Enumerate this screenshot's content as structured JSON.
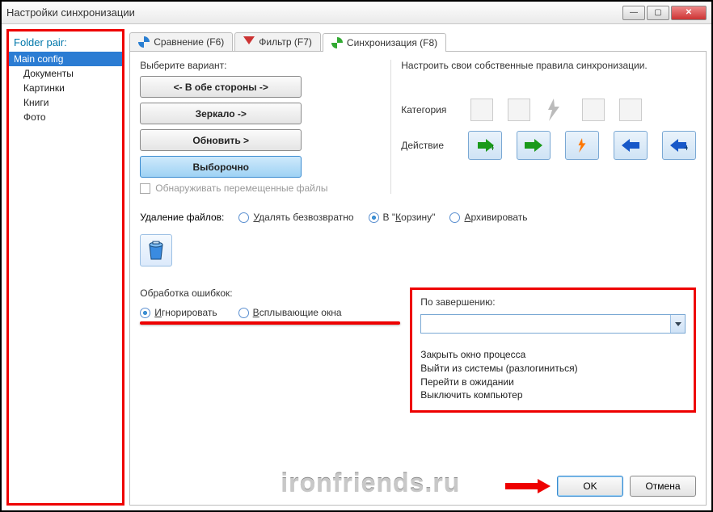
{
  "window": {
    "title": "Настройки синхронизации"
  },
  "sidebar": {
    "heading": "Folder pair:",
    "items": [
      {
        "label": "Main config",
        "selected": true
      },
      {
        "label": "Документы"
      },
      {
        "label": "Картинки"
      },
      {
        "label": "Книги"
      },
      {
        "label": "Фото"
      }
    ]
  },
  "tabs": {
    "compare": "Сравнение (F6)",
    "filter": "Фильтр (F7)",
    "sync": "Синхронизация (F8)"
  },
  "variant": {
    "label": "Выберите вариант:",
    "both": "<- В обе стороны ->",
    "mirror": "Зеркало ->",
    "update": "Обновить >",
    "custom": "Выборочно",
    "detect": "Обнаруживать перемещенные файлы"
  },
  "right": {
    "desc": "Настроить свои собственные правила синхронизации.",
    "category": "Категория",
    "action": "Действие"
  },
  "delete": {
    "label": "Удаление файлов:",
    "perm": "Удалять безвозвратно",
    "recycle_pre": "В \"",
    "recycle_u": "К",
    "recycle_post": "орзину\"",
    "archive_u": "А",
    "archive_post": "рхивировать"
  },
  "errors": {
    "label": "Обработка ошибкок:",
    "ignore_u": "И",
    "ignore_post": "гнорировать",
    "popup_u": "В",
    "popup_post": "сплывающие окна"
  },
  "finish": {
    "label": "По завершению:",
    "opts": [
      "Закрыть окно процесса",
      "Выйти из системы (разлогиниться)",
      "Перейти в ожидании",
      "Выключить компьютер"
    ]
  },
  "buttons": {
    "ok": "OK",
    "cancel": "Отмена"
  },
  "watermark": "ironfriends.ru",
  "perm_u": "У",
  "perm_post": "далять безвозвратно"
}
